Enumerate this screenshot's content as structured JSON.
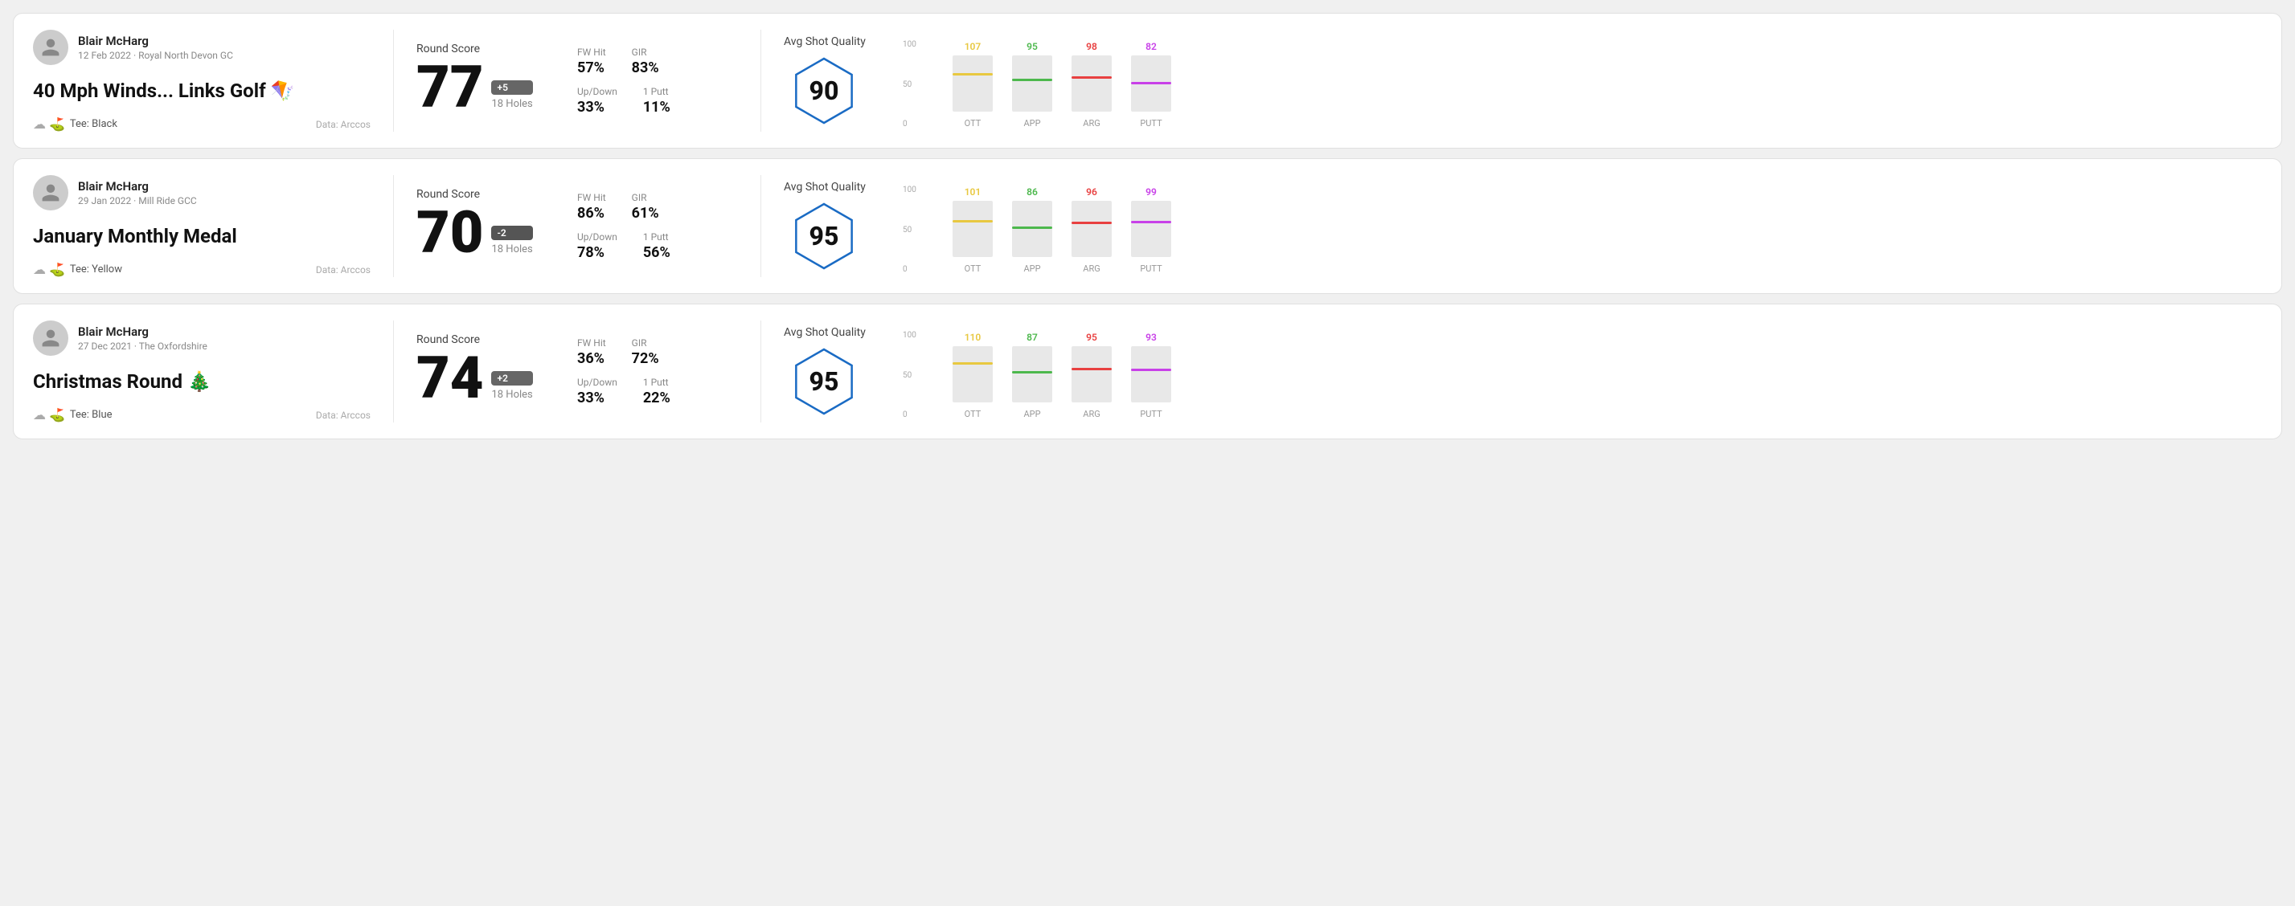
{
  "cards": [
    {
      "id": "card-1",
      "user": {
        "name": "Blair McHarg",
        "meta": "12 Feb 2022 · Royal North Devon GC"
      },
      "title": "40 Mph Winds... Links Golf 🪁",
      "tee": "Tee: Black",
      "data_source": "Data: Arccos",
      "score": {
        "label": "Round Score",
        "number": "77",
        "badge": "+5",
        "badge_type": "positive",
        "holes": "18 Holes"
      },
      "stats": [
        {
          "label": "FW Hit",
          "value": "57%"
        },
        {
          "label": "GIR",
          "value": "83%"
        },
        {
          "label": "Up/Down",
          "value": "33%"
        },
        {
          "label": "1 Putt",
          "value": "11%"
        }
      ],
      "quality": {
        "label": "Avg Shot Quality",
        "score": "90"
      },
      "chart": {
        "bars": [
          {
            "label": "OTT",
            "value": 107,
            "color": "#e8c840",
            "pct": 65
          },
          {
            "label": "APP",
            "value": 95,
            "color": "#4db84d",
            "pct": 55
          },
          {
            "label": "ARG",
            "value": 98,
            "color": "#e84040",
            "pct": 58
          },
          {
            "label": "PUTT",
            "value": 82,
            "color": "#c840e8",
            "pct": 48
          }
        ]
      }
    },
    {
      "id": "card-2",
      "user": {
        "name": "Blair McHarg",
        "meta": "29 Jan 2022 · Mill Ride GCC"
      },
      "title": "January Monthly Medal",
      "tee": "Tee: Yellow",
      "data_source": "Data: Arccos",
      "score": {
        "label": "Round Score",
        "number": "70",
        "badge": "-2",
        "badge_type": "negative",
        "holes": "18 Holes"
      },
      "stats": [
        {
          "label": "FW Hit",
          "value": "86%"
        },
        {
          "label": "GIR",
          "value": "61%"
        },
        {
          "label": "Up/Down",
          "value": "78%"
        },
        {
          "label": "1 Putt",
          "value": "56%"
        }
      ],
      "quality": {
        "label": "Avg Shot Quality",
        "score": "95"
      },
      "chart": {
        "bars": [
          {
            "label": "OTT",
            "value": 101,
            "color": "#e8c840",
            "pct": 62
          },
          {
            "label": "APP",
            "value": 86,
            "color": "#4db84d",
            "pct": 50
          },
          {
            "label": "ARG",
            "value": 96,
            "color": "#e84040",
            "pct": 58
          },
          {
            "label": "PUTT",
            "value": 99,
            "color": "#c840e8",
            "pct": 60
          }
        ]
      }
    },
    {
      "id": "card-3",
      "user": {
        "name": "Blair McHarg",
        "meta": "27 Dec 2021 · The Oxfordshire"
      },
      "title": "Christmas Round 🎄",
      "tee": "Tee: Blue",
      "data_source": "Data: Arccos",
      "score": {
        "label": "Round Score",
        "number": "74",
        "badge": "+2",
        "badge_type": "positive",
        "holes": "18 Holes"
      },
      "stats": [
        {
          "label": "FW Hit",
          "value": "36%"
        },
        {
          "label": "GIR",
          "value": "72%"
        },
        {
          "label": "Up/Down",
          "value": "33%"
        },
        {
          "label": "1 Putt",
          "value": "22%"
        }
      ],
      "quality": {
        "label": "Avg Shot Quality",
        "score": "95"
      },
      "chart": {
        "bars": [
          {
            "label": "OTT",
            "value": 110,
            "color": "#e8c840",
            "pct": 67
          },
          {
            "label": "APP",
            "value": 87,
            "color": "#4db84d",
            "pct": 51
          },
          {
            "label": "ARG",
            "value": 95,
            "color": "#e84040",
            "pct": 57
          },
          {
            "label": "PUTT",
            "value": 93,
            "color": "#c840e8",
            "pct": 56
          }
        ]
      }
    }
  ],
  "y_axis_labels": [
    "100",
    "50",
    "0"
  ]
}
